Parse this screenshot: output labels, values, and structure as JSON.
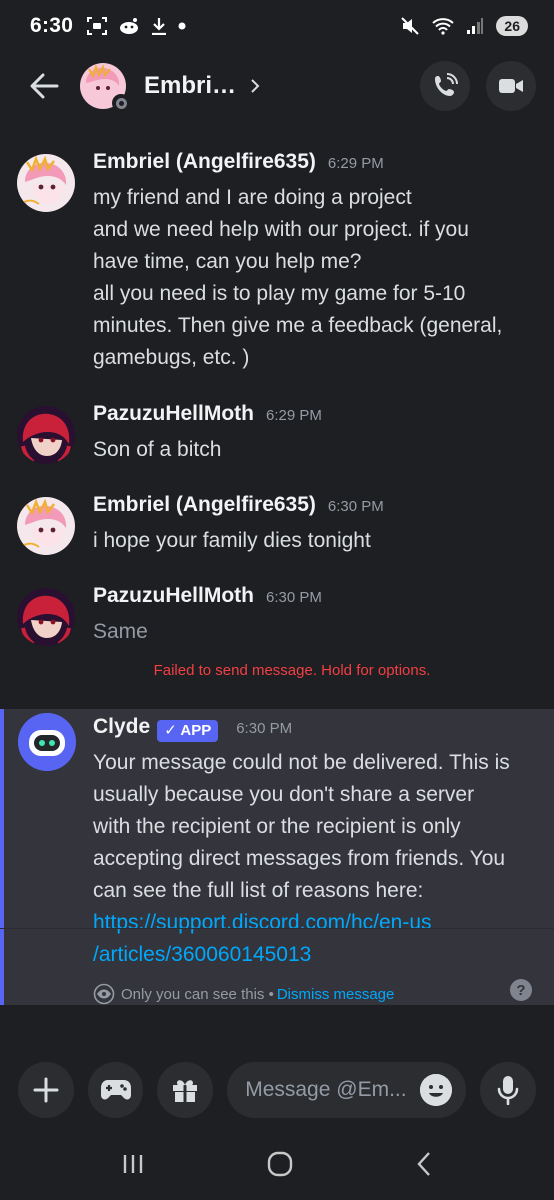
{
  "status_bar": {
    "time": "6:30",
    "battery": "26",
    "icons": [
      "screenshot-icon",
      "reddit-icon",
      "download-icon",
      "dot-icon",
      "mute-icon",
      "wifi-icon",
      "signal-icon"
    ]
  },
  "header": {
    "name": "Embri…",
    "icons": [
      "back-arrow-icon",
      "chevron-right-icon",
      "voice-call-icon",
      "video-call-icon"
    ]
  },
  "messages": [
    {
      "username": "Embriel (Angelfire635)",
      "time": "6:29 PM",
      "lines": [
        "my friend and I are doing a project",
        "and we need help with our project. if you",
        "have time, can you help me?",
        "all you need is to play my game for 5-10",
        "minutes. Then give me a feedback (general,",
        "gamebugs, etc. )"
      ]
    },
    {
      "username": "PazuzuHellMoth",
      "time": "6:29 PM",
      "lines": [
        "Son of a bitch"
      ]
    },
    {
      "username": "Embriel (Angelfire635)",
      "time": "6:30 PM",
      "lines": [
        "i hope your family dies tonight"
      ]
    },
    {
      "username": "PazuzuHellMoth",
      "time": "6:30 PM",
      "lines": [
        "Same"
      ]
    }
  ],
  "failed_note": "Failed to send message. Hold for options.",
  "clyde": {
    "username": "Clyde",
    "badge": "✓ APP",
    "time": "6:30 PM",
    "lines": [
      "Your message could not be delivered. This is",
      "usually because you don't share a server",
      "with the recipient or the recipient is only",
      "accepting direct messages from friends. You",
      "can see the full list of reasons here:"
    ],
    "link_lines": [
      "https://support.discord.com/hc/en-us",
      "/articles/360060145013"
    ],
    "only_you": "Only you can see this •",
    "dismiss": "Dismiss message",
    "help": "?"
  },
  "composer": {
    "placeholder": "Message @Em..."
  },
  "colors": {
    "background": "#1e1f22",
    "accent": "#5865f2",
    "link": "#00a8fc",
    "error": "#f23f43"
  }
}
